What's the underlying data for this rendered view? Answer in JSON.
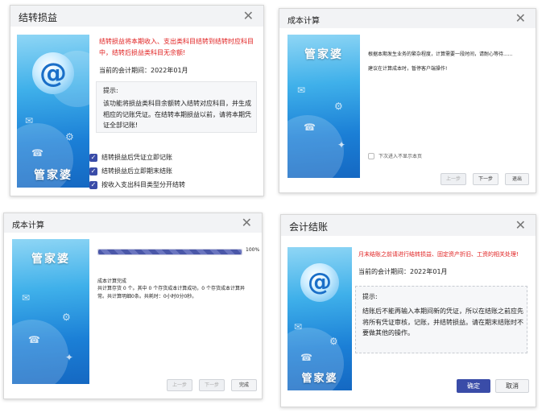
{
  "brand": "管家婆",
  "at_symbol": "@",
  "dialog1": {
    "title": "结转损益",
    "warning": "结转损益将本期收入、支出类科目结转到结转时应科目中，结转后损益类科目无余额!",
    "period_label": "当前的会计期间：2022年01月",
    "hint_title": "提示:",
    "hint_body": "该功能将损益类科目余额转入结转对应科目，并生成相应的记账凭证。在结转本期损益以前，请将本期凭证全部记账!",
    "options": [
      {
        "label": "结转损益后凭证立即记账",
        "checked": true
      },
      {
        "label": "结转损益后立即期末结账",
        "checked": true
      },
      {
        "label": "按收入支出科目类型分开结转",
        "checked": true
      }
    ]
  },
  "dialog2": {
    "title": "成本计算",
    "line1": "根据本期发生业务的繁杂程度，计算需要一段时间，请耐心等待......",
    "line2": "建议在计算成本时，暂停客户端操作!",
    "dont_show": "下次进入不显示本页",
    "buttons": {
      "prev": "上一步",
      "next": "下一步",
      "exit": "退出"
    }
  },
  "dialog3": {
    "title": "成本计算",
    "progress_pct": 100,
    "progress_text": "100%",
    "status_title": "成本计算完成",
    "status_body": "共计算存货 0 个。其中 0 个存货成本计算成功，0 个存货成本计算异常。共计算明细0条。共耗时：0小时0分0秒。",
    "buttons": {
      "prev": "上一步",
      "next": "下一步",
      "finish": "完成"
    }
  },
  "dialog4": {
    "title": "会计结账",
    "warning": "月末结账之前请进行结转损益、固定资产折旧、工资的相关处理!",
    "period_label": "当前的会计期间：2022年01月",
    "hint_title": "提示:",
    "hint_body": "结账后不能再输入本期间新的凭证，所以在结账之前应先将所有凭证审核，记账，并结转损益。请在期末结账时不要做其他的操作。",
    "buttons": {
      "ok": "确定",
      "cancel": "取消"
    }
  }
}
